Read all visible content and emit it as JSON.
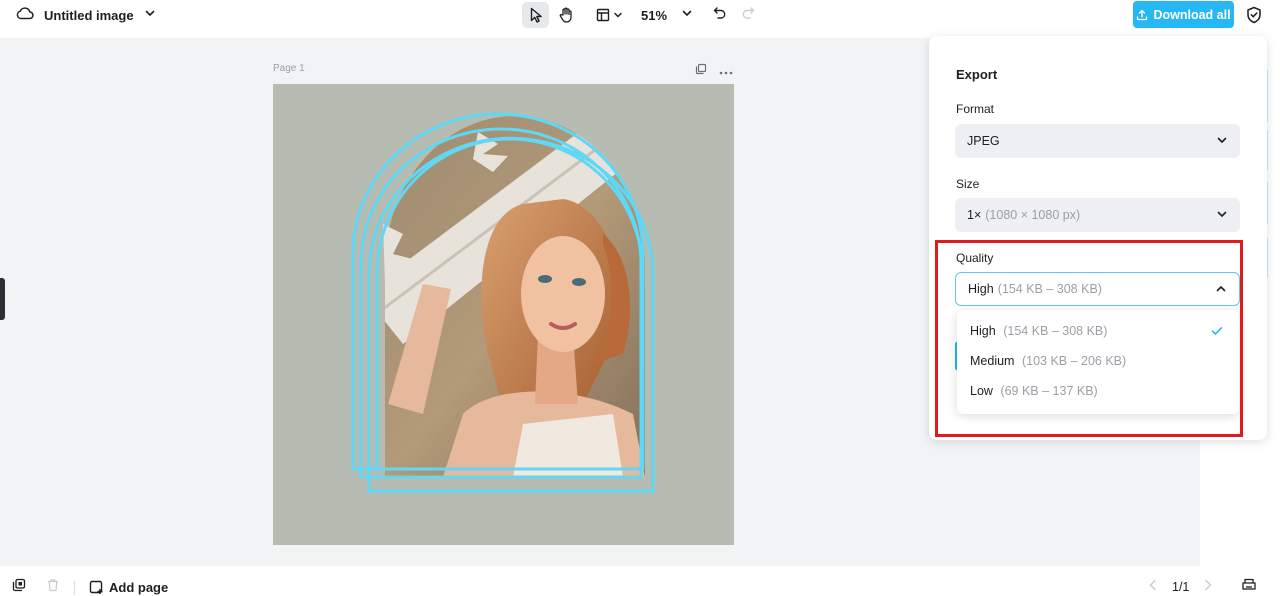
{
  "header": {
    "doc_title": "Untitled image",
    "zoom": "51%",
    "download_label": "Download all"
  },
  "canvas": {
    "page_label": "Page 1"
  },
  "export": {
    "title": "Export",
    "format_label": "Format",
    "format_value": "JPEG",
    "size_label": "Size",
    "size_value": "1×",
    "size_detail": "(1080 × 1080 px)",
    "quality_label": "Quality",
    "quality_value": "High",
    "quality_detail": "(154 KB – 308 KB)",
    "quality_options": [
      {
        "label": "High",
        "detail": "(154 KB – 308 KB)",
        "selected": true
      },
      {
        "label": "Medium",
        "detail": "(103 KB – 206 KB)",
        "selected": false
      },
      {
        "label": "Low",
        "detail": "(69 KB – 137 KB)",
        "selected": false
      }
    ]
  },
  "footer": {
    "add_page_label": "Add page",
    "page_counter": "1/1"
  },
  "colors": {
    "accent": "#27b7f2",
    "highlight": "#e01b1b",
    "artboard_bg": "#b6bcb1",
    "arch_stroke": "#5fd8f5"
  }
}
